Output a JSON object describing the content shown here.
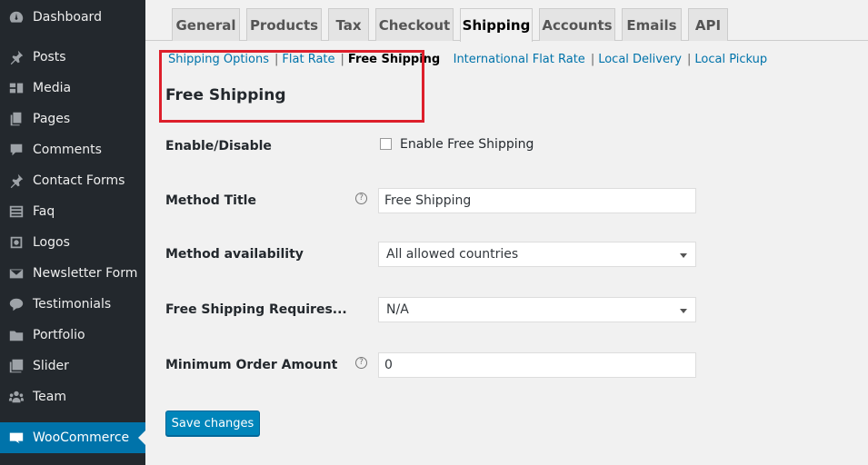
{
  "sidebar": {
    "items": [
      {
        "label": "Dashboard",
        "icon": "dashboard-icon"
      },
      {
        "label": "Posts",
        "icon": "pin-icon"
      },
      {
        "label": "Media",
        "icon": "media-icon"
      },
      {
        "label": "Pages",
        "icon": "pages-icon"
      },
      {
        "label": "Comments",
        "icon": "comment-icon"
      },
      {
        "label": "Contact Forms",
        "icon": "pin-icon"
      },
      {
        "label": "Faq",
        "icon": "list-icon"
      },
      {
        "label": "Logos",
        "icon": "camera-icon"
      },
      {
        "label": "Newsletter Form",
        "icon": "envelope-icon"
      },
      {
        "label": "Testimonials",
        "icon": "chat-bubble-icon"
      },
      {
        "label": "Portfolio",
        "icon": "folder-icon"
      },
      {
        "label": "Slider",
        "icon": "gallery-icon"
      },
      {
        "label": "Team",
        "icon": "team-icon"
      },
      {
        "label": "WooCommerce",
        "icon": "woocommerce-icon",
        "active": true
      }
    ]
  },
  "tabs": [
    "General",
    "Products",
    "Tax",
    "Checkout",
    "Shipping",
    "Accounts",
    "Emails",
    "API"
  ],
  "active_tab": "Shipping",
  "sublinks": {
    "items": [
      "Shipping Options",
      "Flat Rate",
      "Free Shipping",
      "International Flat Rate",
      "Local Delivery",
      "Local Pickup"
    ],
    "current": "Free Shipping",
    "separator": "|"
  },
  "section_title": "Free Shipping",
  "form": {
    "enable_label": "Enable/Disable",
    "enable_checkbox_label": "Enable Free Shipping",
    "enable_checked": false,
    "method_title_label": "Method Title",
    "method_title_value": "Free Shipping",
    "availability_label": "Method availability",
    "availability_value": "All allowed countries",
    "requires_label": "Free Shipping Requires...",
    "requires_value": "N/A",
    "min_amount_label": "Minimum Order Amount",
    "min_amount_value": "0",
    "help_glyph": "?"
  },
  "save_button": "Save changes",
  "colors": {
    "sidebar_bg": "#23282d",
    "accent": "#0073aa",
    "highlight_box": "#dd1f2b",
    "button": "#0085ba"
  }
}
